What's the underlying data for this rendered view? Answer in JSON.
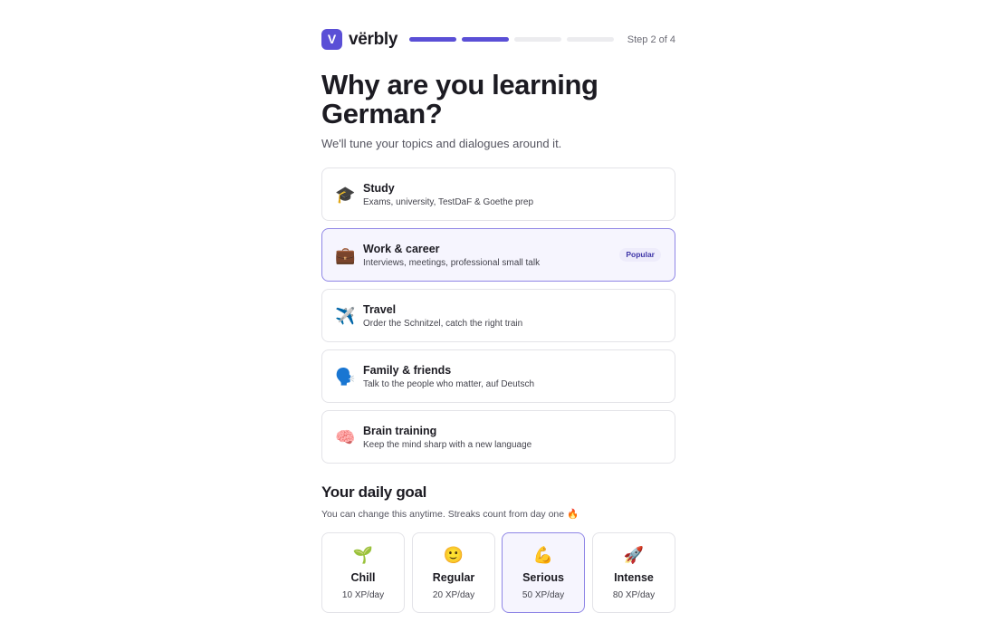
{
  "brand": {
    "logo_letter": "V",
    "name": "vërbly",
    "accent": "#5a4fd6"
  },
  "progress": {
    "current_step": 2,
    "total_steps": 4,
    "label": "Step 2 of 4"
  },
  "title": "Why are you learning German?",
  "subtitle": "We'll tune your topics and dialogues around it.",
  "reasons": [
    {
      "icon": "graduation-cap-icon",
      "emoji": "🎓",
      "title": "Study",
      "desc": "Exams, university, TestDaF & Goethe prep",
      "selected": false
    },
    {
      "icon": "briefcase-icon",
      "emoji": "💼",
      "title": "Work & career",
      "desc": "Interviews, meetings, professional small talk",
      "selected": true,
      "badge": "Popular"
    },
    {
      "icon": "airplane-icon",
      "emoji": "✈️",
      "title": "Travel",
      "desc": "Order the Schnitzel, catch the right train",
      "selected": false
    },
    {
      "icon": "speaking-head-icon",
      "emoji": "🗣️",
      "title": "Family & friends",
      "desc": "Talk to the people who matter, auf Deutsch",
      "selected": false
    },
    {
      "icon": "brain-icon",
      "emoji": "🧠",
      "title": "Brain training",
      "desc": "Keep the mind sharp with a new language",
      "selected": false
    }
  ],
  "goal": {
    "title": "Your daily goal",
    "subtitle": "You can change this anytime. Streaks count from day one 🔥",
    "options": [
      {
        "icon": "seedling-icon",
        "emoji": "🌱",
        "name": "Chill",
        "xp": "10 XP/day",
        "selected": false
      },
      {
        "icon": "smiley-icon",
        "emoji": "🙂",
        "name": "Regular",
        "xp": "20 XP/day",
        "selected": false
      },
      {
        "icon": "flexed-biceps-icon",
        "emoji": "💪",
        "name": "Serious",
        "xp": "50 XP/day",
        "selected": true
      },
      {
        "icon": "rocket-icon",
        "emoji": "🚀",
        "name": "Intense",
        "xp": "80 XP/day",
        "selected": false
      }
    ]
  }
}
